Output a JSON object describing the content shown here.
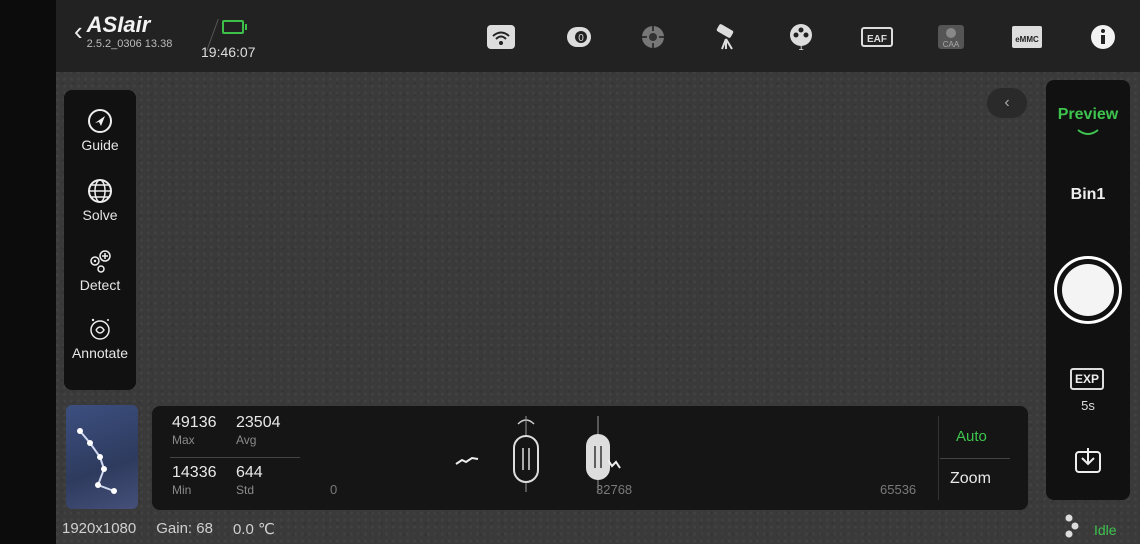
{
  "app": {
    "brand": "ASIair",
    "version": "2.5.2_0306 13.38",
    "clock": "19:46:07"
  },
  "top_icons": [
    {
      "name": "wifi-icon"
    },
    {
      "name": "camera-icon"
    },
    {
      "name": "guide-scope-icon"
    },
    {
      "name": "mount-icon"
    },
    {
      "name": "filter-wheel-icon",
      "label": "1"
    },
    {
      "name": "eaf-icon",
      "label": "EAF"
    },
    {
      "name": "caa-icon",
      "label": "CAA"
    },
    {
      "name": "emmc-icon",
      "label": "eMMC"
    },
    {
      "name": "info-icon"
    }
  ],
  "left_tools": [
    {
      "name": "guide",
      "label": "Guide"
    },
    {
      "name": "solve",
      "label": "Solve"
    },
    {
      "name": "detect",
      "label": "Detect"
    },
    {
      "name": "annotate",
      "label": "Annotate"
    }
  ],
  "right_panel": {
    "preview_label": "Preview",
    "bin_label": "Bin1",
    "exp_badge": "EXP",
    "exp_value": "5s"
  },
  "stats": {
    "max_value": "49136",
    "max_label": "Max",
    "avg_value": "23504",
    "avg_label": "Avg",
    "min_value": "14336",
    "min_label": "Min",
    "std_value": "644",
    "std_label": "Std"
  },
  "histogram": {
    "min_tick": "0",
    "mid_tick": "32768",
    "max_tick": "65536",
    "auto_label": "Auto",
    "zoom_label": "Zoom"
  },
  "status": {
    "resolution": "1920x1080",
    "gain": "Gain: 68",
    "temperature": "0.0 ℃",
    "state": "Idle"
  },
  "colors": {
    "accent_green": "#3ec44e"
  }
}
